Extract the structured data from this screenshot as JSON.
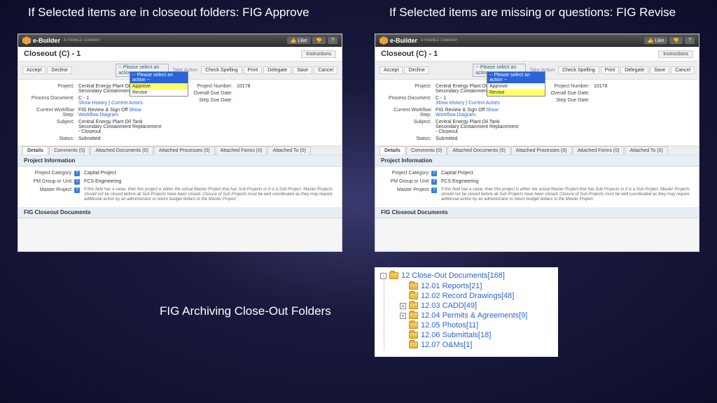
{
  "headings": {
    "left": "If Selected items are in closeout folders: FIG Approve",
    "right": "If Selected items are missing or questions: FIG Revise",
    "mid": "FIG Archiving Close-Out Folders"
  },
  "topbar": {
    "brand": "e-Builder",
    "tagline": "A TRIMBLE COMPANY",
    "like": "👍 Like",
    "help": "?"
  },
  "page": {
    "title": "Closeout (C) - 1",
    "instructions": "Instructions"
  },
  "toolbar": {
    "accept": "Accept",
    "decline": "Decline",
    "action_placeholder": "-- Please select an action --",
    "take_action": "Take Action",
    "check_spelling": "Check Spelling",
    "print": "Print",
    "delegate": "Delegate",
    "save": "Save",
    "cancel": "Cancel"
  },
  "dropdown": {
    "header": "-- Please select an action --",
    "approve": "Approve",
    "revise": "Revise"
  },
  "details": {
    "project_label": "Project:",
    "project_val": "Central Energy Plant Oil Tank Secondary Containment Replacement",
    "process_doc_label": "Process Document:",
    "process_doc_val": "C - 1",
    "show_history": "Show History",
    "current_actors": "Current Actors",
    "workflow_label": "Current Workflow Step:",
    "workflow_val": "FIG Review & Sign Off",
    "show_workflow": "Show Workflow Diagram",
    "subject_label": "Subject:",
    "subject_val": "Central Energy Plant Oil Tank Secondary Containment Replacement - Closeout",
    "status_label": "Status:",
    "status_val": "Submitted",
    "proj_num_label": "Project Number:",
    "proj_num_val": "10178",
    "overall_due_label": "Overall Due Date:",
    "step_due_label": "Step Due Date:"
  },
  "tabs": {
    "details": "Details",
    "comments": "Comments (0)",
    "attached_docs": "Attached Documents (0)",
    "attached_proc": "Attached Processes (0)",
    "attached_forms": "Attached Forms (0)",
    "attached_to": "Attached To (0)"
  },
  "pi": {
    "header": "Project Information",
    "category_label": "Project Category:",
    "category_val": "Capital Project",
    "pm_label": "PM Group or Unit:",
    "pm_val": "FCS Engineering",
    "master_label": "Master Project:",
    "master_note": "If this field has a value, then this project is either the actual Master Project that has Sub Projects or it is a Sub Project.  Master Projects should not be closed before all Sub Projects have been closed.  Closure of Sub Projects must be well coordinated as they may require additional action by an administrator to return budget dollars to the Master Project.",
    "closeout_header": "FIG Closeout Documents"
  },
  "tree": {
    "root": "12 Close-Out Documents[168]",
    "items": [
      {
        "label": "12.01 Reports[21]",
        "exp": ""
      },
      {
        "label": "12.02 Record Drawings[48]",
        "exp": ""
      },
      {
        "label": "12.03 CADD[49]",
        "exp": "+"
      },
      {
        "label": "12.04 Permits & Agreements[9]",
        "exp": "+"
      },
      {
        "label": "12.05 Photos[11]",
        "exp": ""
      },
      {
        "label": "12.06 Submittals[18]",
        "exp": ""
      },
      {
        "label": "12.07 O&Ms[1]",
        "exp": ""
      }
    ]
  }
}
